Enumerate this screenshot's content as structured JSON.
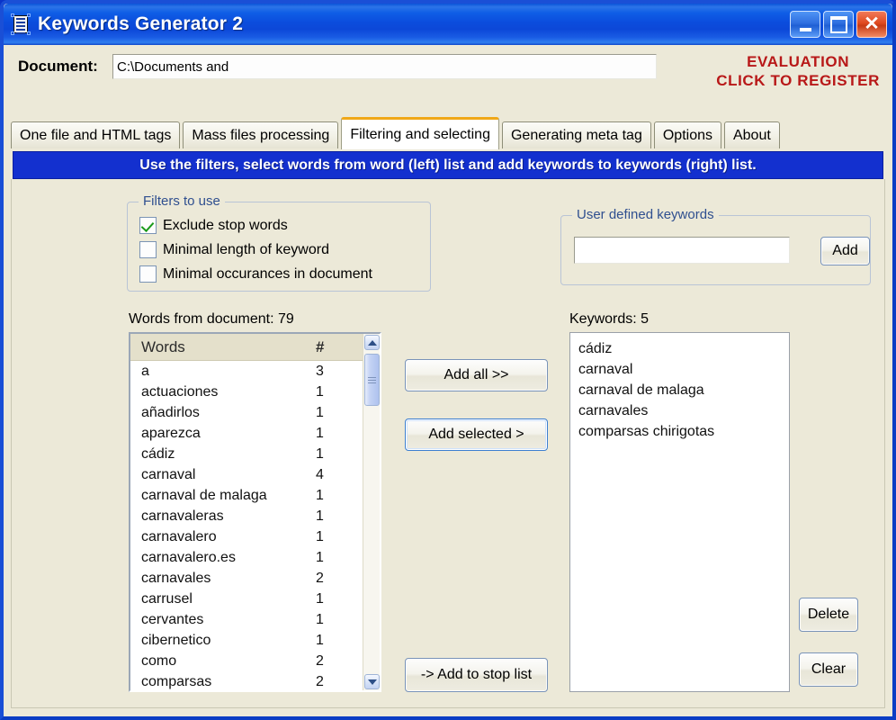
{
  "window": {
    "title": "Keywords Generator 2",
    "icon": "document-list-icon",
    "minimize_label": "_",
    "maximize_label": "□",
    "close_label": "✕"
  },
  "document_bar": {
    "label": "Document:",
    "value": "C:\\Documents and",
    "placeholder": ""
  },
  "evaluation": {
    "line1": "EVALUATION",
    "line2": "CLICK TO REGISTER",
    "color": "#b81818"
  },
  "tabs": [
    {
      "label": "One file and HTML tags",
      "active": false
    },
    {
      "label": "Mass files processing",
      "active": false
    },
    {
      "label": "Filtering and selecting",
      "active": true
    },
    {
      "label": "Generating meta tag",
      "active": false
    },
    {
      "label": "Options",
      "active": false
    },
    {
      "label": "About",
      "active": false
    }
  ],
  "banner": {
    "text": "Use the filters, select words from word (left) list and add keywords to keywords (right) list.",
    "background": "#1330cf",
    "color": "#ffffff"
  },
  "filters": {
    "legend": "Filters to use",
    "items": [
      {
        "label": "Exclude stop words",
        "checked": true
      },
      {
        "label": "Minimal length of keyword",
        "checked": false
      },
      {
        "label": "Minimal occurances in document",
        "checked": false
      }
    ]
  },
  "user_defined_keywords": {
    "legend": "User defined keywords",
    "input_value": "",
    "placeholder": "",
    "add_label": "Add"
  },
  "words_panel": {
    "caption": "Words from document: 79",
    "count": 79,
    "columns": [
      "Words",
      "#"
    ],
    "rows": [
      {
        "word": "a",
        "count": "3"
      },
      {
        "word": "actuaciones",
        "count": "1"
      },
      {
        "word": "añadirlos",
        "count": "1"
      },
      {
        "word": "aparezca",
        "count": "1"
      },
      {
        "word": "cádiz",
        "count": "1"
      },
      {
        "word": "carnaval",
        "count": "4"
      },
      {
        "word": "carnaval de malaga",
        "count": "1"
      },
      {
        "word": "carnavaleras",
        "count": "1"
      },
      {
        "word": "carnavalero",
        "count": "1"
      },
      {
        "word": "carnavalero.es",
        "count": "1"
      },
      {
        "word": "carnavales",
        "count": "2"
      },
      {
        "word": "carrusel",
        "count": "1"
      },
      {
        "word": "cervantes",
        "count": "1"
      },
      {
        "word": "cibernetico",
        "count": "1"
      },
      {
        "word": "como",
        "count": "2"
      },
      {
        "word": "comparsas",
        "count": "2"
      }
    ]
  },
  "keywords_panel": {
    "caption": "Keywords: 5",
    "count": 5,
    "items": [
      "cádiz",
      "carnaval",
      "carnaval de malaga",
      "carnavales",
      "comparsas chirigotas"
    ]
  },
  "actions": {
    "add_all": "Add all >>",
    "add_selected": "Add selected >",
    "add_to_stop_list": "-> Add to stop list",
    "delete": "Delete",
    "clear": "Clear"
  },
  "scrollbar": {
    "up_icon": "chevron-up-icon",
    "down_icon": "chevron-down-icon"
  }
}
